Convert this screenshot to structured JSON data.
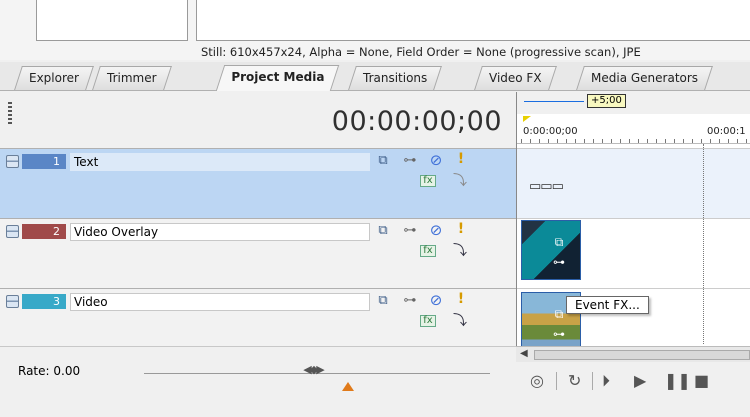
{
  "media_info": "Still: 610x457x24, Alpha = None, Field Order = None (progressive scan), JPE",
  "tabs": [
    {
      "label": "Explorer"
    },
    {
      "label": "Trimmer"
    },
    {
      "label": "Project Media",
      "active": true
    },
    {
      "label": "Transitions"
    },
    {
      "label": "Video FX"
    },
    {
      "label": "Media Generators"
    }
  ],
  "timecode": "00:00:00;00",
  "tracks": [
    {
      "number": "1",
      "name": "Text",
      "color": "#5a86c6",
      "selected": true
    },
    {
      "number": "2",
      "name": "Video Overlay",
      "color": "#a04a4a",
      "selected": false
    },
    {
      "number": "3",
      "name": "Video",
      "color": "#38a9c8",
      "selected": false
    }
  ],
  "rate": {
    "label": "Rate: 0.00"
  },
  "timeline": {
    "marker_label": "+5;00",
    "ruler_start": "0:00:00;00",
    "ruler_next": "00:00:1"
  },
  "tooltip": "Event FX...",
  "icons": {
    "compositing": "compositing-mode-icon",
    "motion": "track-motion-icon",
    "mute": "mute-icon",
    "solo": "solo-icon",
    "fx": "track-fx-icon",
    "parent": "make-compositing-child-icon"
  },
  "transport": [
    "record",
    "loop",
    "play-from-start",
    "play",
    "pause",
    "stop"
  ]
}
